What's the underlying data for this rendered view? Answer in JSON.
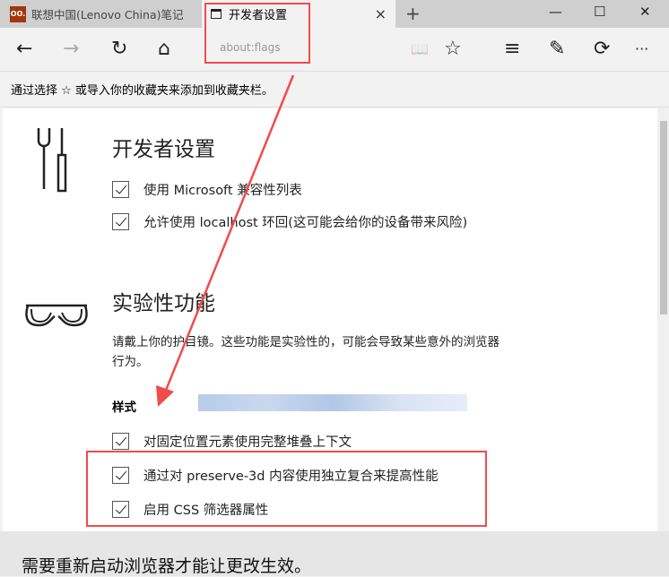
{
  "tabs": [
    {
      "label": "联想中国(Lenovo China)笔记",
      "favicon": "OO."
    },
    {
      "label": "开发者设置",
      "close": "×"
    }
  ],
  "new_tab": "+",
  "window": {
    "minimize": "—",
    "maximize": "☐",
    "close": "✕"
  },
  "address": "about:flags",
  "nav_icons": {
    "back": "←",
    "forward": "→",
    "refresh": "↻",
    "home": "⌂",
    "reading": "📖",
    "favorite": "☆",
    "hub": "≡",
    "note": "✎",
    "share": "⟳",
    "more": "···"
  },
  "favorites_bar": "通过选择 ☆ 或导入你的收藏夹来添加到收藏夹栏。",
  "dev": {
    "title": "开发者设置",
    "items": [
      "使用 Microsoft 兼容性列表",
      "允许使用 localhost 环回(这可能会给你的设备带来风险)"
    ]
  },
  "exp": {
    "title": "实验性功能",
    "desc": "请戴上你的护目镜。这些功能是实验性的，可能会导致某些意外的浏览器行为。",
    "section": "样式",
    "items": [
      "对固定位置元素使用完整堆叠上下文",
      "通过对 preserve-3d 内容使用独立复合来提高性能",
      "启用 CSS 筛选器属性"
    ]
  },
  "restart_notice": "需要重新启动浏览器才能让更改生效。",
  "accent": "#f24b4b"
}
